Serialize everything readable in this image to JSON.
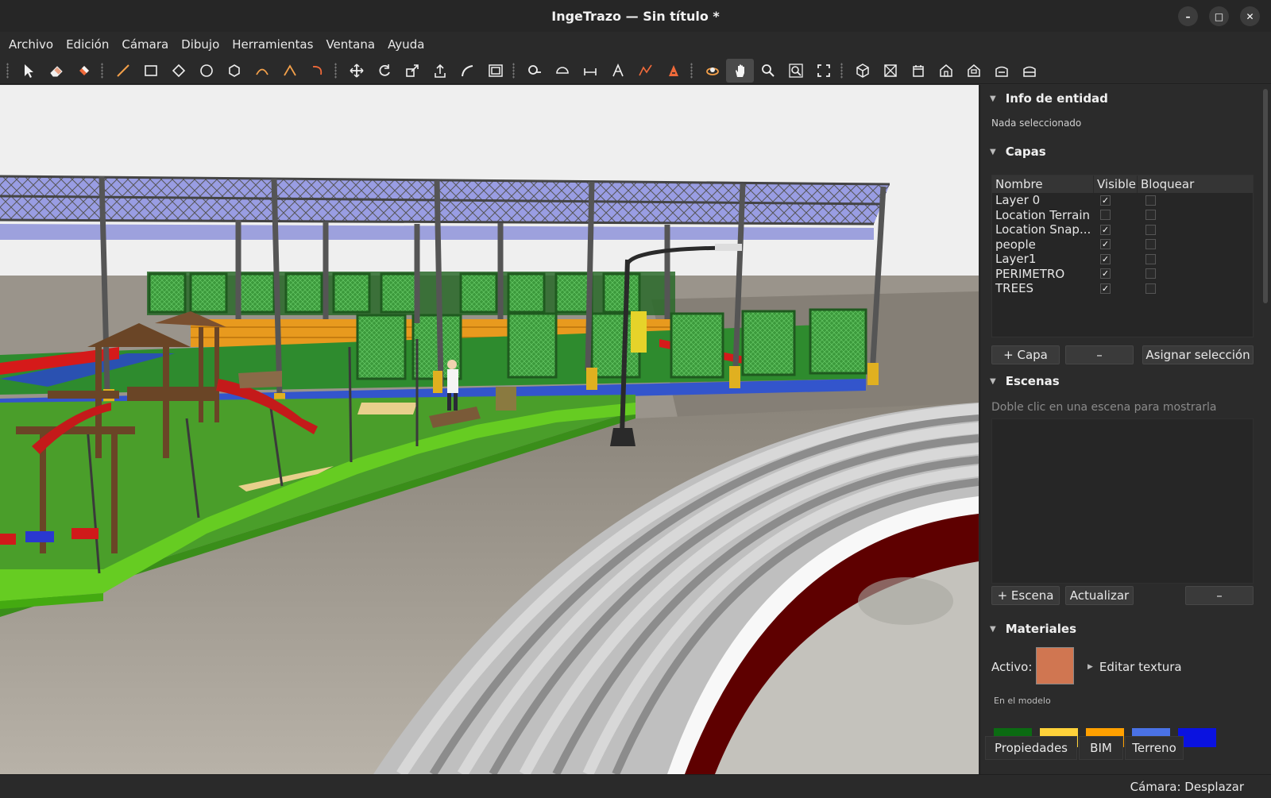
{
  "window": {
    "title": "IngeTrazo — Sin título *",
    "minimize": "–",
    "maximize": "□",
    "close": "✕"
  },
  "menu": [
    "Archivo",
    "Edición",
    "Cámara",
    "Dibujo",
    "Herramientas",
    "Ventana",
    "Ayuda"
  ],
  "toolbar_icons": [
    "select-icon",
    "eraser-icon",
    "paint-bucket-icon",
    "line-icon",
    "rectangle-icon",
    "rotated-rectangle-icon",
    "circle-icon",
    "polygon-icon",
    "arc-icon",
    "two-point-arc-icon",
    "pie-icon",
    "move-icon",
    "rotate-icon",
    "scale-icon",
    "push-pull-icon",
    "follow-me-icon",
    "offset-icon",
    "tape-measure-icon",
    "protractor-icon",
    "dimension-icon",
    "text-icon",
    "axes-icon",
    "3d-text-icon",
    "orbit-icon",
    "pan-icon",
    "zoom-icon",
    "zoom-window-icon",
    "zoom-extents-icon",
    "iso-view-icon",
    "top-view-icon",
    "front-view-icon",
    "right-view-icon",
    "back-view-icon",
    "left-view-icon",
    "bottom-view-icon"
  ],
  "entity_info": {
    "title": "Info de entidad",
    "status": "Nada seleccionado"
  },
  "layers": {
    "title": "Capas",
    "columns": [
      "Nombre",
      "Visible",
      "Bloquear"
    ],
    "rows": [
      {
        "name": "Layer 0",
        "visible": true,
        "locked": false
      },
      {
        "name": "Location Terrain",
        "visible": false,
        "locked": false
      },
      {
        "name": "Location Snap...",
        "visible": true,
        "locked": false
      },
      {
        "name": "people",
        "visible": true,
        "locked": false
      },
      {
        "name": "Layer1",
        "visible": true,
        "locked": false
      },
      {
        "name": "PERIMETRO",
        "visible": true,
        "locked": false
      },
      {
        "name": "TREES",
        "visible": true,
        "locked": false
      }
    ],
    "add_button": "+ Capa",
    "remove_button": "–",
    "assign_button": "Asignar selección"
  },
  "scenes": {
    "title": "Escenas",
    "hint": "Doble clic en una escena para mostrarla",
    "add_button": "+ Escena",
    "update_button": "Actualizar",
    "remove_button": "–"
  },
  "materials": {
    "title": "Materiales",
    "active_label": "Activo:",
    "active_color": "#d07651",
    "edit_texture": "Editar textura",
    "in_model_label": "En el modelo",
    "swatches": [
      "#0b6b12",
      "#ffd23a",
      "#ffa000",
      "#4a72e6",
      "#0a12e0"
    ]
  },
  "panel_tabs": [
    "Propiedades",
    "BIM",
    "Terreno"
  ],
  "status": {
    "camera": "Cámara: Desplazar"
  }
}
